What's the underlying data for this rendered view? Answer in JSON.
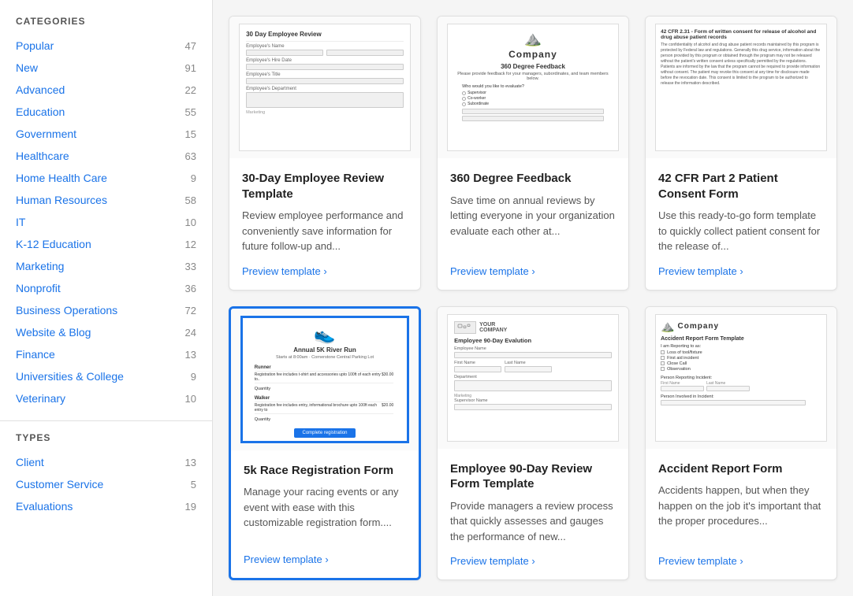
{
  "sidebar": {
    "categories_title": "CATEGORIES",
    "types_title": "TYPES",
    "categories": [
      {
        "label": "Popular",
        "count": 47
      },
      {
        "label": "New",
        "count": 91
      },
      {
        "label": "Advanced",
        "count": 22
      },
      {
        "label": "Education",
        "count": 55
      },
      {
        "label": "Government",
        "count": 15
      },
      {
        "label": "Healthcare",
        "count": 63
      },
      {
        "label": "Home Health Care",
        "count": 9
      },
      {
        "label": "Human Resources",
        "count": 58
      },
      {
        "label": "IT",
        "count": 10
      },
      {
        "label": "K-12 Education",
        "count": 12
      },
      {
        "label": "Marketing",
        "count": 33
      },
      {
        "label": "Nonprofit",
        "count": 36
      },
      {
        "label": "Business Operations",
        "count": 72
      },
      {
        "label": "Website & Blog",
        "count": 24
      },
      {
        "label": "Finance",
        "count": 13
      },
      {
        "label": "Universities & College",
        "count": 9
      },
      {
        "label": "Veterinary",
        "count": 10
      }
    ],
    "types": [
      {
        "label": "Client",
        "count": 13
      },
      {
        "label": "Customer Service",
        "count": 5
      },
      {
        "label": "Evaluations",
        "count": 19
      }
    ]
  },
  "cards": [
    {
      "id": "card-1",
      "title": "30-Day Employee Review Template",
      "description": "Review employee performance and conveniently save information for future follow-up and...",
      "link": "Preview template ›",
      "selected": false
    },
    {
      "id": "card-2",
      "title": "360 Degree Feedback",
      "description": "Save time on annual reviews by letting everyone in your organization evaluate each other at...",
      "link": "Preview template ›",
      "selected": false
    },
    {
      "id": "card-3",
      "title": "42 CFR Part 2 Patient Consent Form",
      "description": "Use this ready-to-go form template to quickly collect patient consent for the release of...",
      "link": "Preview template ›",
      "selected": false
    },
    {
      "id": "card-4",
      "title": "5k Race Registration Form",
      "description": "Manage your racing events or any event with ease with this customizable registration form....",
      "link": "Preview template ›",
      "selected": true
    },
    {
      "id": "card-5",
      "title": "Employee 90-Day Review Form Template",
      "description": "Provide managers a review process that quickly assesses and gauges the performance of new...",
      "link": "Preview template ›",
      "selected": false
    },
    {
      "id": "card-6",
      "title": "Accident Report Form",
      "description": "Accidents happen, but when they happen on the job it's important that the proper procedures...",
      "link": "Preview template ›",
      "selected": false
    }
  ]
}
